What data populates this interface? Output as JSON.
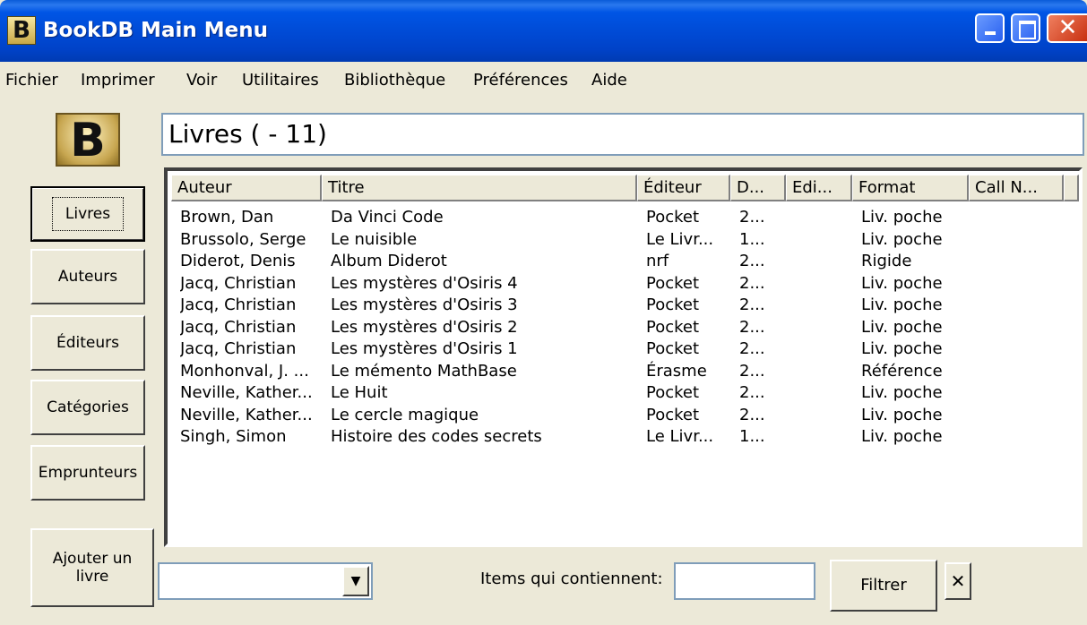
{
  "window": {
    "title": "BookDB Main Menu",
    "logo_letter": "B",
    "controls": {
      "minimize": "minimize-icon",
      "maximize": "maximize-icon",
      "close": "✕"
    }
  },
  "menu": [
    "Fichier",
    "Imprimer",
    "Voir",
    "Utilitaires",
    "Bibliothèque",
    "Préférences",
    "Aide"
  ],
  "logo_large": "B",
  "page_title": "Livres ( - 11)",
  "sidebar": {
    "items": [
      "Livres",
      "Auteurs",
      "Éditeurs",
      "Catégories",
      "Emprunteurs"
    ],
    "active": "Livres",
    "add_line1": "Ajouter un",
    "add_line2": "livre"
  },
  "table": {
    "columns": [
      "Auteur",
      "Titre",
      "Éditeur",
      "D...",
      "Edi...",
      "Format",
      "Call N..."
    ],
    "rows": [
      [
        "Brown, Dan",
        "Da Vinci Code",
        "Pocket",
        "2...",
        "",
        "Liv. poche",
        ""
      ],
      [
        "Brussolo, Serge",
        "Le nuisible",
        "Le Livr...",
        "1...",
        "",
        "Liv. poche",
        ""
      ],
      [
        "Diderot, Denis",
        "Album Diderot",
        "nrf",
        "2...",
        "",
        "Rigide",
        ""
      ],
      [
        "Jacq, Christian",
        "Les mystères d'Osiris 4",
        "Pocket",
        "2...",
        "",
        "Liv. poche",
        ""
      ],
      [
        "Jacq, Christian",
        "Les mystères d'Osiris 3",
        "Pocket",
        "2...",
        "",
        "Liv. poche",
        ""
      ],
      [
        "Jacq, Christian",
        "Les mystères d'Osiris 2",
        "Pocket",
        "2...",
        "",
        "Liv. poche",
        ""
      ],
      [
        "Jacq, Christian",
        "Les mystères d'Osiris 1",
        "Pocket",
        "2...",
        "",
        "Liv. poche",
        ""
      ],
      [
        "Monhonval, J. ...",
        "Le mémento MathBase",
        "Érasme",
        "2...",
        "",
        "Référence",
        ""
      ],
      [
        "Neville, Kather...",
        "Le Huit",
        "Pocket",
        "2...",
        "",
        "Liv. poche",
        ""
      ],
      [
        "Neville, Kather...",
        "Le cercle magique",
        "Pocket",
        "2...",
        "",
        "Liv. poche",
        ""
      ],
      [
        "Singh, Simon",
        "Histoire des codes secrets",
        "Le Livr...",
        "1...",
        "",
        "Liv. poche",
        ""
      ]
    ]
  },
  "filter": {
    "combo_value": "",
    "label": "Items qui contiennent:",
    "input_value": "",
    "button": "Filtrer",
    "clear": "✕"
  }
}
